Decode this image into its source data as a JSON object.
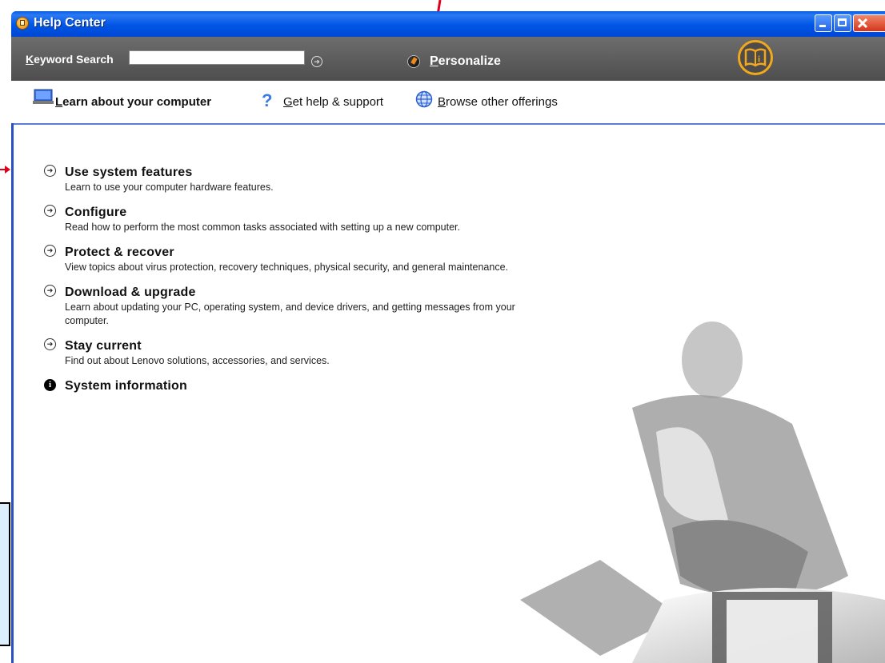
{
  "window": {
    "title": "Help Center"
  },
  "toolbar": {
    "keyword_label_first": "K",
    "keyword_label_rest": "eyword Search",
    "search_value": "",
    "personalize_first": "P",
    "personalize_rest": "ersonalize"
  },
  "nav": {
    "learn_first": "L",
    "learn_rest": "earn about your computer",
    "help_first": "G",
    "help_rest": "et help & support",
    "browse_first": "B",
    "browse_rest": "rowse other offerings"
  },
  "topics": [
    {
      "title": "Use system features",
      "desc": "Learn to use your computer hardware features."
    },
    {
      "title": "Configure",
      "desc": "Read how to perform the most common tasks associated with setting up a new computer."
    },
    {
      "title": "Protect & recover",
      "desc": "View topics about virus protection, recovery techniques, physical security, and general maintenance."
    },
    {
      "title": "Download & upgrade",
      "desc": "Learn about updating your PC, operating system, and device drivers, and getting messages from your computer."
    },
    {
      "title": "Stay current",
      "desc": "Find out about Lenovo solutions, accessories, and services."
    },
    {
      "title": "System information",
      "desc": ""
    }
  ],
  "icons": {
    "app": "help-center-icon",
    "go": "arrow-circle-icon",
    "personalize": "personalize-icon",
    "brand": "book-info-icon",
    "computer": "laptop-icon",
    "help": "question-icon",
    "browse": "globe-icon",
    "info": "info-icon"
  },
  "colors": {
    "titlebar": "#0055e5",
    "toolbar": "#5a5a5a",
    "accent": "#f2a81a",
    "annotation": "#e0001a"
  }
}
